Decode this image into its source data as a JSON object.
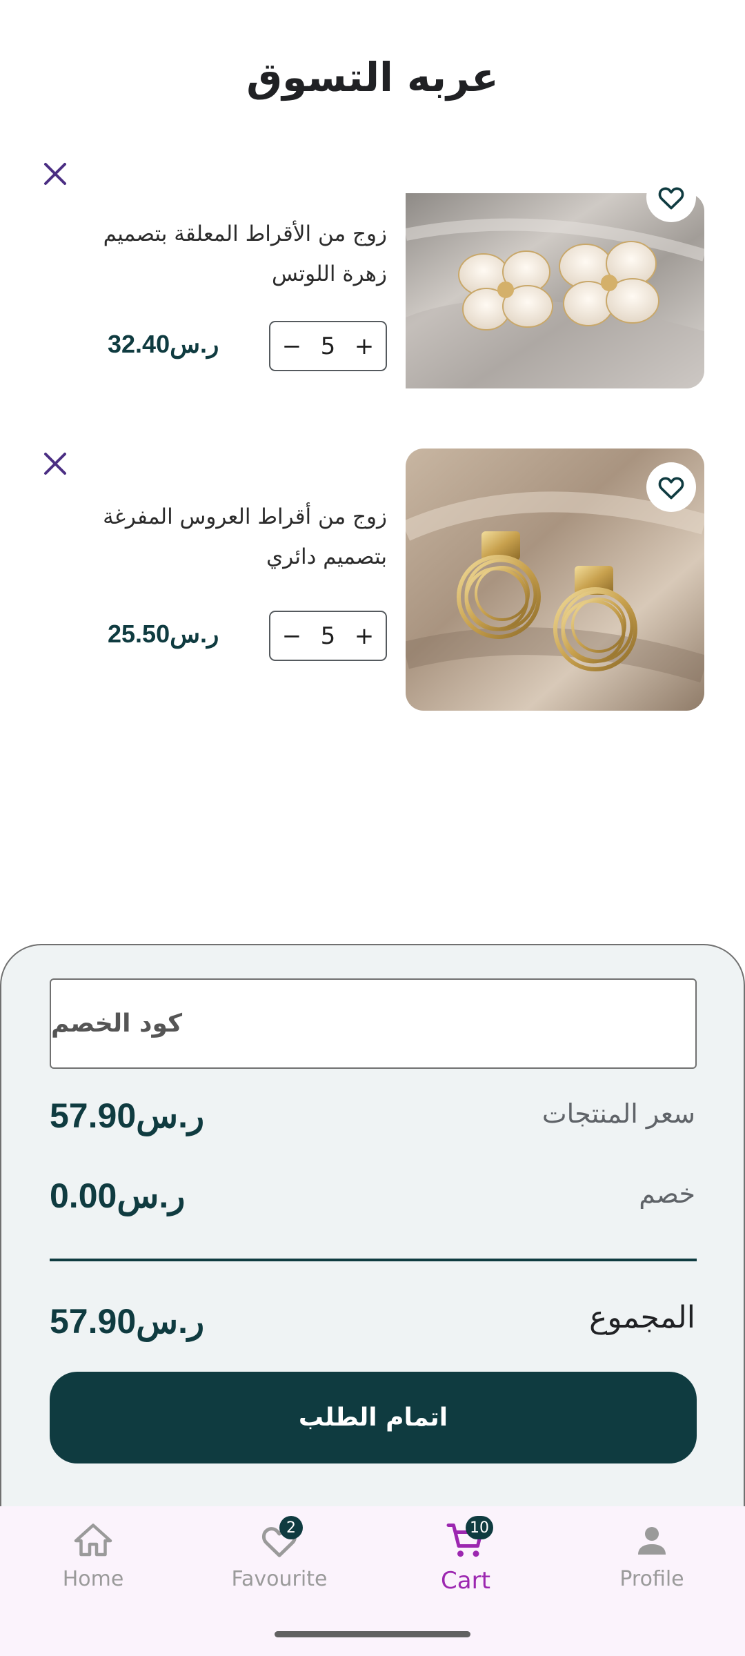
{
  "header": {
    "title": "عربه التسوق"
  },
  "cart_items": [
    {
      "name": "زوج من الأقراط المعلقة بتصميم زهرة اللوتس",
      "quantity": "5",
      "price": "32.40ر.س",
      "minus": "−",
      "plus": "+"
    },
    {
      "name": "زوج من أقراط العروس المفرغة بتصميم دائري",
      "quantity": "5",
      "price": "25.50ر.س",
      "minus": "−",
      "plus": "+"
    }
  ],
  "summary": {
    "coupon_placeholder": "كود الخصم",
    "subtotal_label": "سعر المنتجات",
    "subtotal_value": "57.90ر.س",
    "discount_label": "خصم",
    "discount_value": "0.00ر.س",
    "total_label": "المجموع",
    "total_value": "57.90ر.س",
    "checkout_label": "اتمام الطلب"
  },
  "bottom_nav": {
    "items": [
      {
        "label": "Home",
        "icon": "home-icon"
      },
      {
        "label": "Favourite",
        "icon": "heart-icon",
        "badge": "2"
      },
      {
        "label": "Cart",
        "icon": "cart-icon",
        "badge": "10",
        "active": true
      },
      {
        "label": "Profile",
        "icon": "person-icon"
      }
    ]
  },
  "colors": {
    "primary": "#0f3b40",
    "accent": "#9c27b0",
    "remove_icon": "#4b2e83"
  }
}
